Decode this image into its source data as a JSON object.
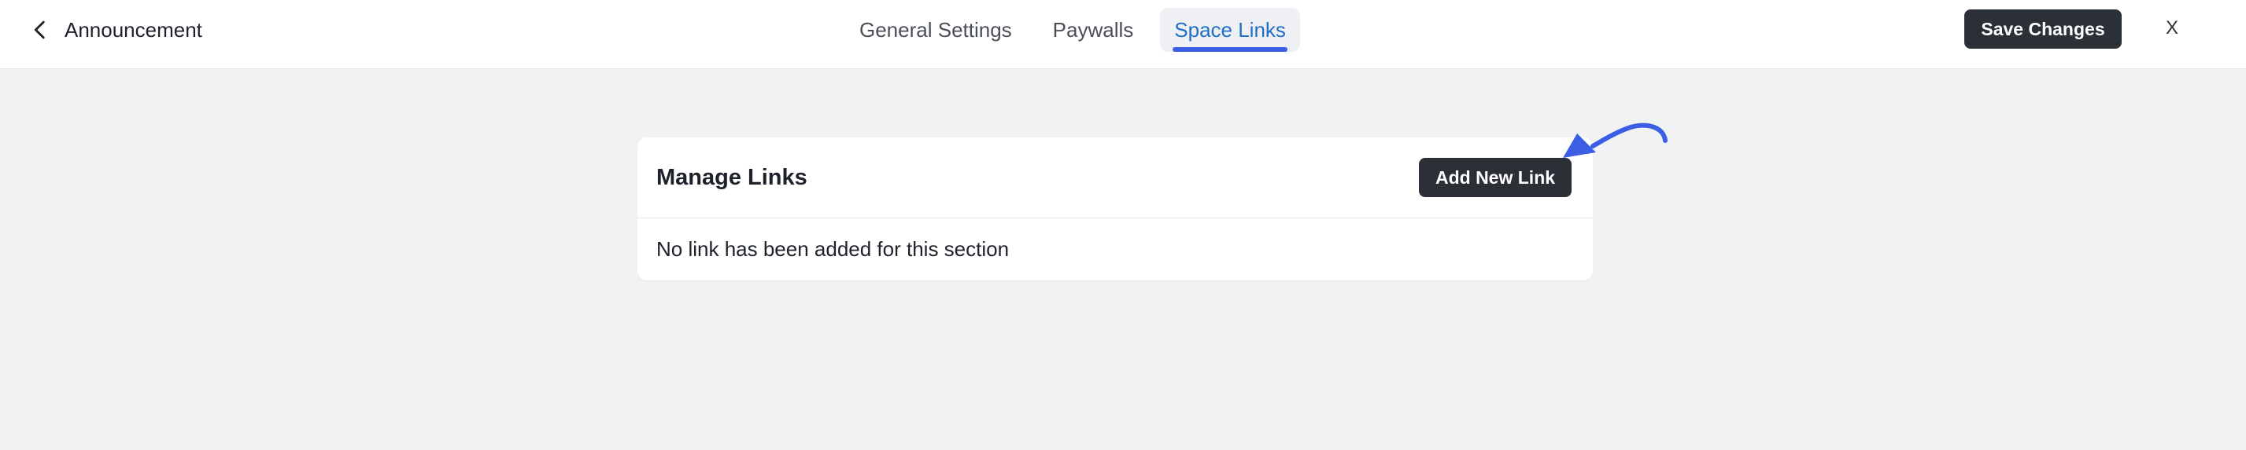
{
  "header": {
    "back_label": "Announcement",
    "tabs": [
      {
        "label": "General Settings",
        "active": false
      },
      {
        "label": "Paywalls",
        "active": false
      },
      {
        "label": "Space Links",
        "active": true
      }
    ],
    "save_label": "Save Changes",
    "close_label": "X"
  },
  "card": {
    "title": "Manage Links",
    "add_label": "Add New Link",
    "empty_message": "No link has been added for this section"
  },
  "colors": {
    "background": "#f1f2f4",
    "active_tab_text": "#1f6fc5",
    "accent_underline": "#3c5ee4",
    "dark_button": "#2b2f36",
    "annotation_arrow": "#3c5ee4"
  },
  "icons": {
    "back": "chevron-left-icon",
    "annotation": "curved-arrow-icon"
  }
}
